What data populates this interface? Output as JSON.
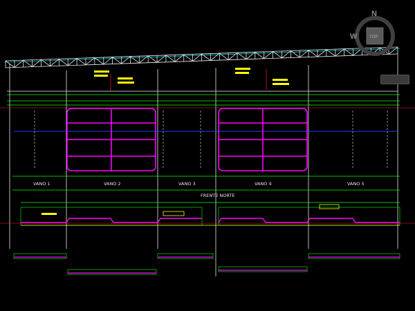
{
  "drawing": {
    "bay_labels": [
      "VANO 1",
      "VANO 2",
      "VANO 3",
      "VANO 4",
      "VANO 5"
    ],
    "front_label": "FRENTE NORTE",
    "colors": {
      "background": "#000000",
      "truss": "#f0f0f0",
      "frame": "#ff00ff",
      "green": "#00ff00",
      "yellow": "#ffff00",
      "red": "#ff2020",
      "blue": "#2040ff",
      "cyan": "#00ffff"
    }
  },
  "viewcube": {
    "north": "N",
    "west": "W",
    "top": "TOP"
  }
}
